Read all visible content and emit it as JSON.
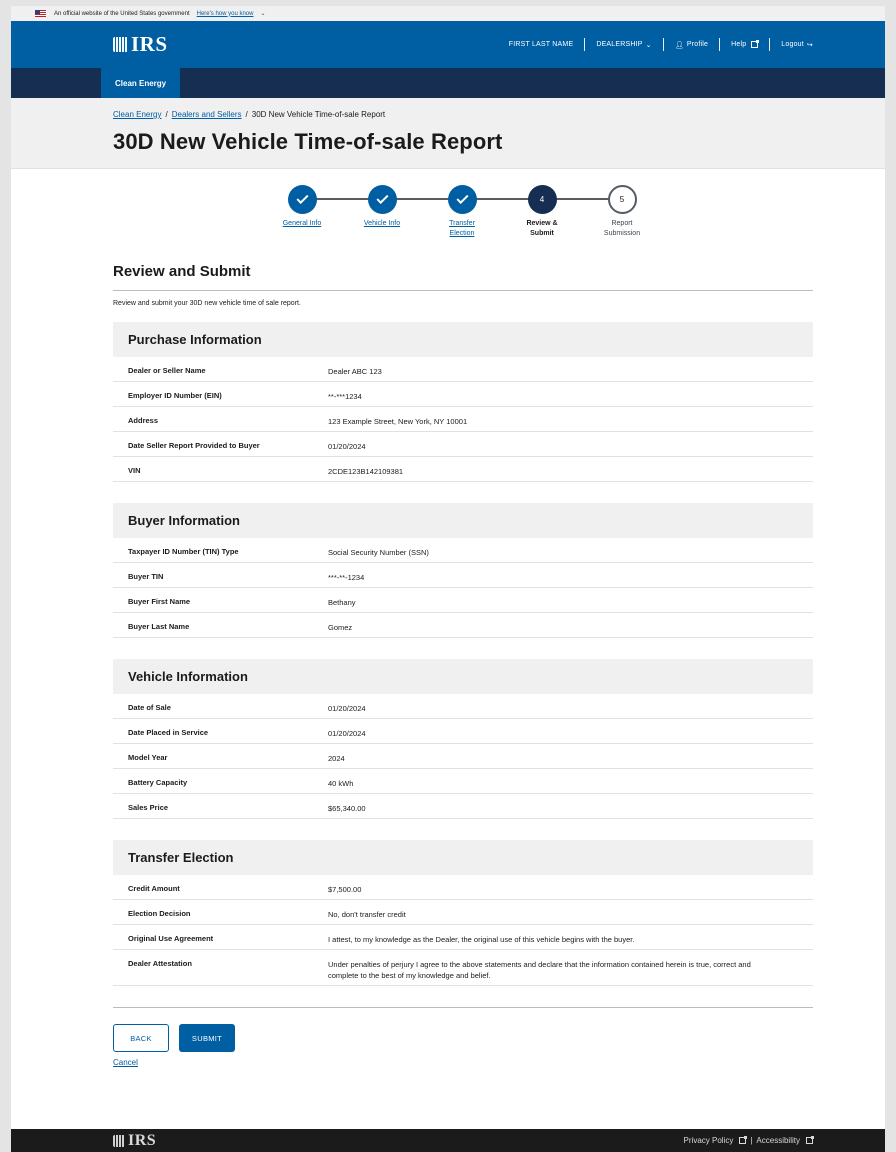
{
  "gov_banner": {
    "text": "An official website of the United States government",
    "link": "Here's how you know"
  },
  "header": {
    "logo": "IRS",
    "user_name": "FIRST LAST NAME",
    "dealership": "DEALERSHIP",
    "profile": "Profile",
    "help": "Help",
    "logout": "Logout"
  },
  "subnav": {
    "active_tab": "Clean Energy"
  },
  "breadcrumb": {
    "items": [
      "Clean Energy",
      "Dealers and Sellers"
    ],
    "current": "30D New Vehicle Time-of-sale Report"
  },
  "page_title": "30D New Vehicle Time-of-sale Report",
  "steps": [
    {
      "label1": "General Info",
      "label2": "",
      "number": "1",
      "state": "complete"
    },
    {
      "label1": "Vehicle Info",
      "label2": "",
      "number": "2",
      "state": "complete"
    },
    {
      "label1": "Transfer",
      "label2": "Election",
      "number": "3",
      "state": "complete"
    },
    {
      "label1": "Review &",
      "label2": "Submit",
      "number": "4",
      "state": "current"
    },
    {
      "label1": "Report",
      "label2": "Submission",
      "number": "5",
      "state": "upcoming"
    }
  ],
  "review": {
    "heading": "Review and Submit",
    "intro": "Review and submit your 30D new vehicle time of sale report."
  },
  "sections": {
    "purchase": {
      "title": "Purchase Information",
      "rows": [
        {
          "label": "Dealer or Seller Name",
          "value": "Dealer ABC 123"
        },
        {
          "label": "Employer ID Number (EIN)",
          "value": "**-***1234"
        },
        {
          "label": "Address",
          "value": "123 Example Street, New York, NY 10001"
        },
        {
          "label": "Date Seller Report Provided to Buyer",
          "value": "01/20/2024"
        },
        {
          "label": "VIN",
          "value": "2CDE123B142109381"
        }
      ]
    },
    "buyer": {
      "title": "Buyer Information",
      "rows": [
        {
          "label": "Taxpayer ID Number (TIN) Type",
          "value": "Social Security Number (SSN)"
        },
        {
          "label": "Buyer TIN",
          "value": "***-**-1234"
        },
        {
          "label": "Buyer First Name",
          "value": "Bethany"
        },
        {
          "label": "Buyer Last Name",
          "value": "Gomez"
        }
      ]
    },
    "vehicle": {
      "title": "Vehicle Information",
      "rows": [
        {
          "label": "Date of Sale",
          "value": "01/20/2024"
        },
        {
          "label": "Date Placed in Service",
          "value": "01/20/2024"
        },
        {
          "label": "Model Year",
          "value": "2024"
        },
        {
          "label": "Battery Capacity",
          "value": "40 kWh"
        },
        {
          "label": "Sales Price",
          "value": "$65,340.00"
        }
      ]
    },
    "transfer": {
      "title": "Transfer Election",
      "rows": [
        {
          "label": "Credit Amount",
          "value": "$7,500.00"
        },
        {
          "label": "Election Decision",
          "value": "No, don't transfer credit"
        },
        {
          "label": "Original Use Agreement",
          "value": "I attest, to my knowledge as the Dealer, the original use of this vehicle begins with the buyer."
        },
        {
          "label": "Dealer Attestation",
          "value": "Under penalties of perjury I agree to the above statements and declare that the information contained herein is true, correct and complete to the best of my knowledge and belief."
        }
      ]
    }
  },
  "actions": {
    "back": "BACK",
    "submit": "SUBMIT",
    "cancel": "Cancel"
  },
  "footer": {
    "logo": "IRS",
    "privacy": "Privacy Policy",
    "separator": "|",
    "accessibility": "Accessibility"
  },
  "colors": {
    "primary": "#005ea2",
    "navy": "#162e51",
    "footer": "#1b1b1b"
  }
}
